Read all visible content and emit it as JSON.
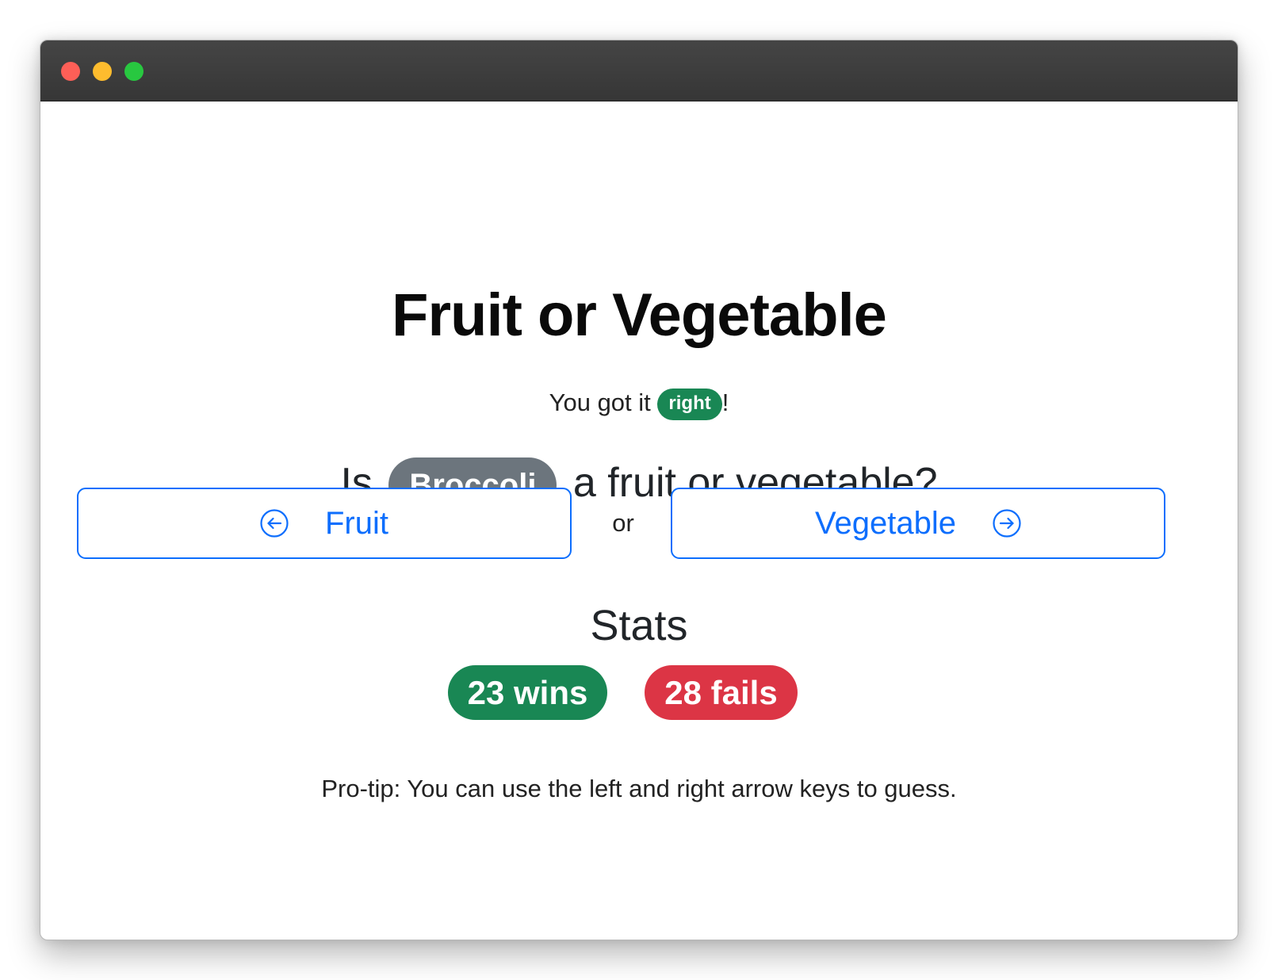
{
  "window": {
    "controls": [
      "close",
      "minimize",
      "zoom"
    ]
  },
  "game": {
    "title": "Fruit or Vegetable",
    "feedback_prefix": "You got it",
    "feedback_result": "right",
    "feedback_suffix": "!",
    "question_prefix": "Is",
    "item": "Broccoli",
    "question_suffix": "a fruit or vegetable?"
  },
  "choices": {
    "fruit_label": "Fruit",
    "fruit_icon": "arrow-left-circle-icon",
    "separator": "or",
    "vegetable_label": "Vegetable",
    "vegetable_icon": "arrow-right-circle-icon"
  },
  "stats": {
    "heading": "Stats",
    "wins_label": "23 wins",
    "fails_label": "28 fails"
  },
  "footer": {
    "protip": "Pro-tip: You can use the left and right arrow keys to guess."
  },
  "colors": {
    "primary": "#0d6efd",
    "success": "#198754",
    "danger": "#dc3545",
    "secondary": "#6c757d"
  }
}
